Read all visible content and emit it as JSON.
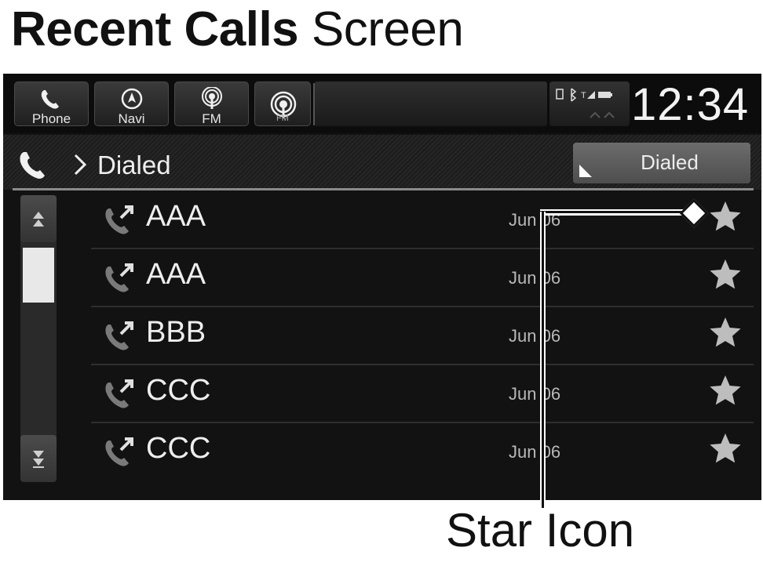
{
  "document": {
    "title_bold": "Recent Calls",
    "title_rest": " Screen",
    "callout_label": "Star Icon"
  },
  "topbar": {
    "sources": [
      {
        "label": "Phone",
        "icon": "phone-icon"
      },
      {
        "label": "Navi",
        "icon": "navi-icon"
      },
      {
        "label": "FM",
        "icon": "radio-icon"
      },
      {
        "label": "FM",
        "icon": "radio-icon"
      }
    ],
    "clock": "12:34"
  },
  "header": {
    "breadcrumb": "Dialed",
    "filter_button": "Dialed"
  },
  "calls": [
    {
      "name": "AAA",
      "date": "Jun 06"
    },
    {
      "name": "AAA",
      "date": "Jun 06"
    },
    {
      "name": "BBB",
      "date": "Jun 06"
    },
    {
      "name": "CCC",
      "date": "Jun 06"
    },
    {
      "name": "CCC",
      "date": "Jun 06"
    }
  ],
  "colors": {
    "screen_bg": "#121212",
    "text_primary": "#eeeeee",
    "star_color": "#bdbdbd"
  }
}
